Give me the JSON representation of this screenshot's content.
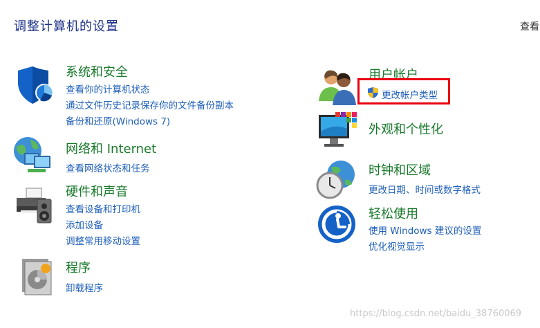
{
  "header": {
    "title": "调整计算机的设置",
    "view_by": "查看"
  },
  "left_categories": [
    {
      "title": "系统和安全",
      "icon": "security-shield-icon",
      "links": [
        "查看你的计算机状态",
        "通过文件历史记录保存你的文件备份副本",
        "备份和还原(Windows 7)"
      ]
    },
    {
      "title": "网络和 Internet",
      "icon": "network-globe-icon",
      "links": [
        "查看网络状态和任务"
      ]
    },
    {
      "title": "硬件和声音",
      "icon": "printer-speaker-icon",
      "links": [
        "查看设备和打印机",
        "添加设备",
        "调整常用移动设置"
      ]
    },
    {
      "title": "程序",
      "icon": "programs-disc-icon",
      "links": [
        "卸载程序"
      ]
    }
  ],
  "right_categories": [
    {
      "title": "用户帐户",
      "icon": "users-icon",
      "links": [
        "更改帐户类型"
      ]
    },
    {
      "title": "外观和个性化",
      "icon": "monitor-palette-icon",
      "links": []
    },
    {
      "title": "时钟和区域",
      "icon": "clock-globe-icon",
      "links": [
        "更改日期、时间或数字格式"
      ]
    },
    {
      "title": "轻松使用",
      "icon": "ease-of-access-icon",
      "links": [
        "使用 Windows 建议的设置",
        "优化视觉显示"
      ]
    }
  ],
  "watermark": "https://blog.csdn.net/baidu_38760069",
  "colors": {
    "category_title": "#1a7a2c",
    "link": "#1f5fb9",
    "highlight": "#e8000f",
    "page_title": "#1e3287"
  }
}
